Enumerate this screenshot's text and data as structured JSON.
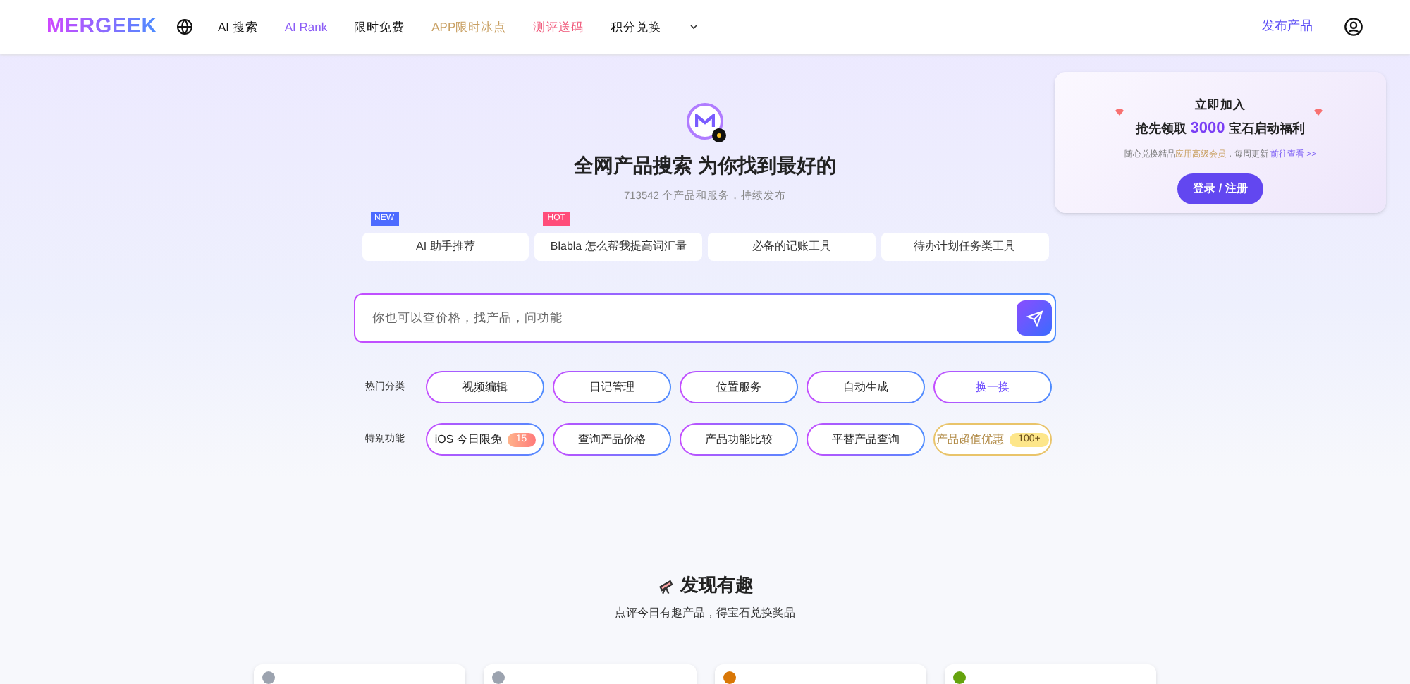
{
  "nav": {
    "logo": "MERGEEK",
    "items": [
      {
        "label": "AI 搜索",
        "color": "#111111"
      },
      {
        "label": "AI Rank",
        "color": "#8b5cf6"
      },
      {
        "label": "限时免费",
        "color": "#111111"
      },
      {
        "label": "APP限时冰点",
        "color": "#c9a063"
      },
      {
        "label": "测评送码",
        "color": "#f0587a"
      },
      {
        "label": "积分兑换",
        "color": "#111111"
      }
    ],
    "publish": "发布产品"
  },
  "hero": {
    "title": "全网产品搜索 为你找到最好的",
    "subtitle": "713542 个产品和服务，持续发布",
    "quick_links": [
      {
        "label": "AI 助手推荐",
        "badge": "NEW",
        "kind": "new"
      },
      {
        "label": "Blabla 怎么帮我提高词汇量",
        "badge": "HOT",
        "kind": "hot"
      },
      {
        "label": "必备的记账工具"
      },
      {
        "label": "待办计划任务类工具"
      }
    ],
    "search": {
      "placeholder": "你也可以查价格，找产品，问功能"
    },
    "hot": {
      "label": "热门分类",
      "chips": [
        {
          "label": "视频编辑",
          "kind": "tag"
        },
        {
          "label": "日记管理",
          "kind": "tag"
        },
        {
          "label": "位置服务",
          "kind": "tag"
        },
        {
          "label": "自动生成",
          "kind": "tag"
        },
        {
          "label": "换一换",
          "kind": "action"
        }
      ]
    },
    "special": {
      "label": "特别功能",
      "chips": [
        {
          "label": "iOS 今日限免",
          "count": "15",
          "kind": "tag"
        },
        {
          "label": "查询产品价格",
          "kind": "tag"
        },
        {
          "label": "产品功能比较",
          "kind": "tag"
        },
        {
          "label": "平替产品查询",
          "kind": "tag"
        },
        {
          "label": "产品超值优惠",
          "count": "100+",
          "kind": "deal"
        }
      ]
    }
  },
  "promo": {
    "line_1": "立即加入",
    "line_2_before": "抢先领取",
    "amount": "3000",
    "line_2_after": "宝石启动福利",
    "note": "随心兑换精品**应用高级会员**，每周更新",
    "link": "前往查看 >>",
    "button": "登录 / 注册"
  },
  "discover": {
    "title": "发现有趣",
    "subtitle": "点评今日有趣产品，得宝石兑换奖品",
    "cards": [
      {
        "color": "#9ca3af"
      },
      {
        "color": "#9ca3af"
      },
      {
        "color": "#d97706"
      },
      {
        "color": "#65a30d"
      }
    ]
  }
}
